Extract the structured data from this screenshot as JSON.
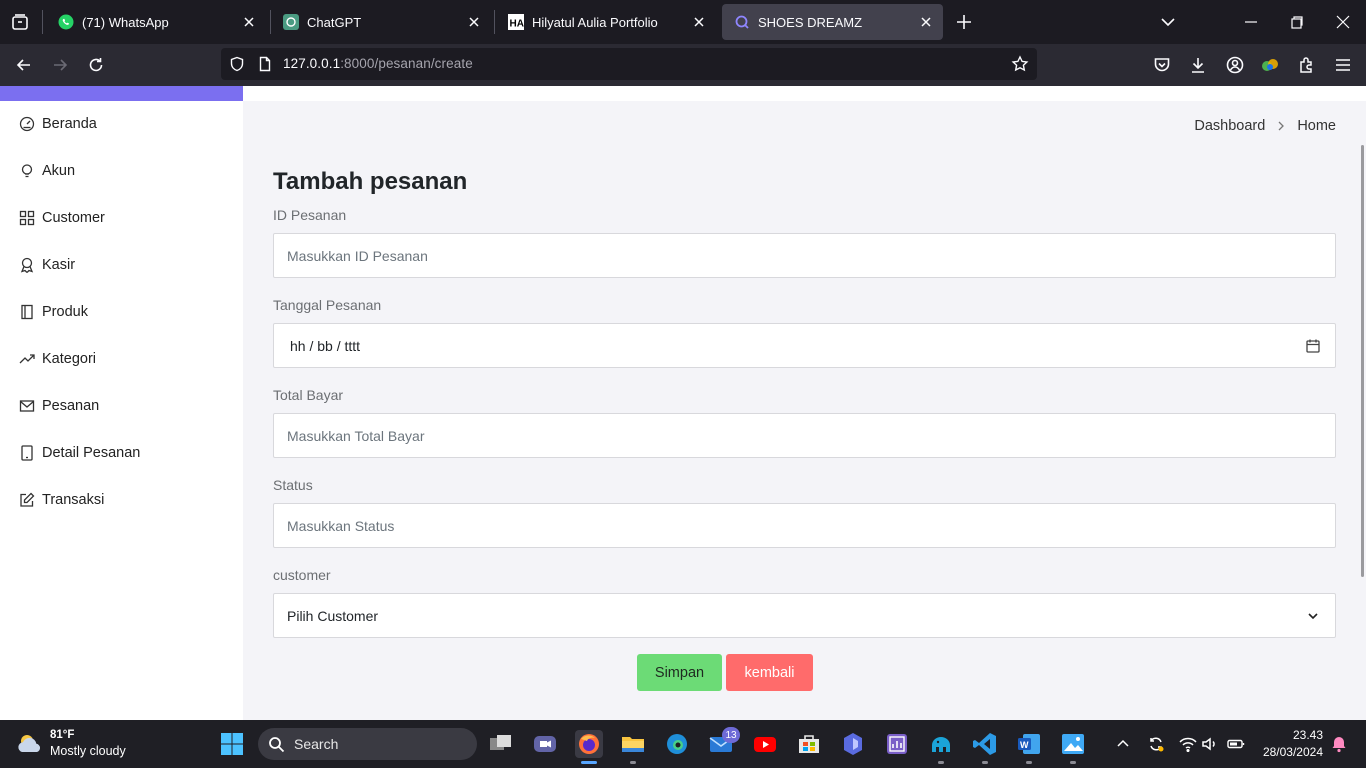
{
  "browser": {
    "tabs": [
      {
        "title": "(71) WhatsApp",
        "icon": "whatsapp-icon"
      },
      {
        "title": "ChatGPT",
        "icon": "chatgpt-icon"
      },
      {
        "title": "Hilyatul Aulia Portfolio",
        "icon": "portfolio-icon"
      },
      {
        "title": "SHOES DREAMZ",
        "icon": "search-q-icon"
      }
    ],
    "url_host": "127.0.0.1",
    "url_rest": ":8000/pesanan/create"
  },
  "sidebar": {
    "items": [
      {
        "label": "Beranda",
        "icon": "dashboard-gauge-icon"
      },
      {
        "label": "Akun",
        "icon": "lightbulb-icon"
      },
      {
        "label": "Customer",
        "icon": "grid-icon"
      },
      {
        "label": "Kasir",
        "icon": "award-icon"
      },
      {
        "label": "Produk",
        "icon": "layout-icon"
      },
      {
        "label": "Kategori",
        "icon": "trending-icon"
      },
      {
        "label": "Pesanan",
        "icon": "envelope-icon"
      },
      {
        "label": "Detail Pesanan",
        "icon": "tablet-icon"
      },
      {
        "label": "Transaksi",
        "icon": "edit-icon"
      }
    ]
  },
  "breadcrumb": {
    "first": "Dashboard",
    "second": "Home"
  },
  "form": {
    "title": "Tambah pesanan",
    "id_label": "ID Pesanan",
    "id_placeholder": "Masukkan ID Pesanan",
    "date_label": "Tanggal Pesanan",
    "date_value": "hh / bb / tttt",
    "total_label": "Total Bayar",
    "total_placeholder": "Masukkan Total Bayar",
    "status_label": "Status",
    "status_placeholder": "Masukkan Status",
    "customer_label": "customer",
    "customer_selected": "Pilih Customer",
    "save_label": "Simpan",
    "back_label": "kembali"
  },
  "taskbar": {
    "temp": "81°F",
    "weather": "Mostly cloudy",
    "search_label": "Search",
    "mail_badge": "13",
    "time": "23.43",
    "date": "28/03/2024"
  },
  "colors": {
    "sidebar_accent": "#7b6ff0",
    "save_button": "#6cdb76",
    "back_button": "#ff6b6b"
  }
}
